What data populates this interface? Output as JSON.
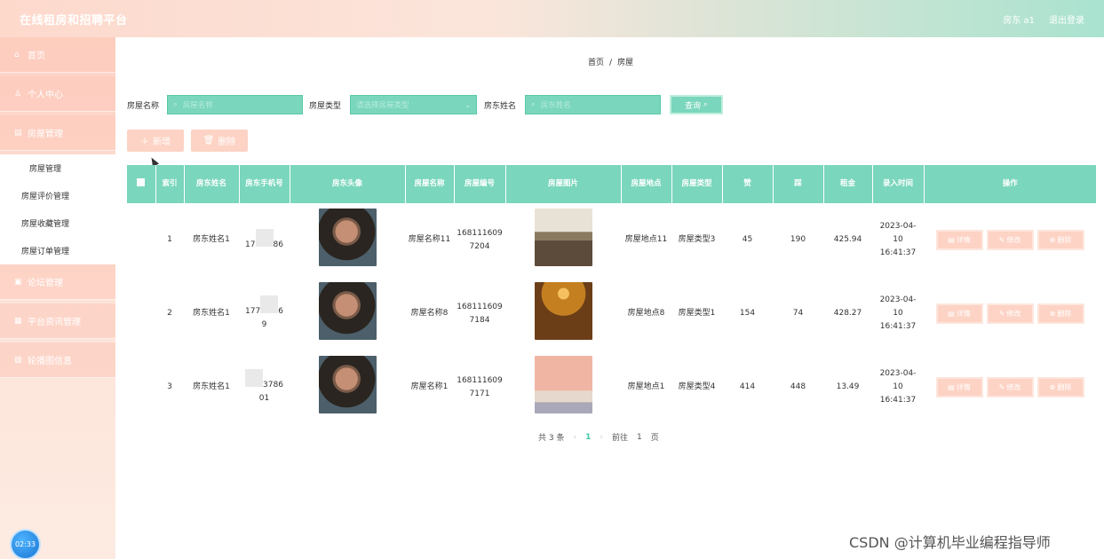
{
  "header": {
    "title": "在线租房和招聘平台",
    "user": "房东 a1",
    "logout": "退出登录"
  },
  "sidebar": {
    "items": [
      {
        "label": "首页",
        "icon": "home-icon"
      },
      {
        "label": "个人中心",
        "icon": "user-icon"
      },
      {
        "label": "房屋管理",
        "icon": "house-icon"
      }
    ],
    "submenu": [
      "房屋管理",
      "房屋评价管理",
      "房屋收藏管理",
      "房屋订单管理"
    ],
    "items2": [
      {
        "label": "论坛管理",
        "icon": "forum-icon"
      },
      {
        "label": "平台资讯管理",
        "icon": "news-icon"
      },
      {
        "label": "轮播图信息",
        "icon": "image-icon"
      }
    ]
  },
  "clock": "02:33",
  "breadcrumb": {
    "home": "首页",
    "sep": "/",
    "current": "房屋"
  },
  "search": {
    "name_label": "房屋名称",
    "name_placeholder": "房屋名称",
    "type_label": "房屋类型",
    "type_placeholder": "请选择房屋类型",
    "owner_label": "房东姓名",
    "owner_placeholder": "房东姓名",
    "query": "查询"
  },
  "actions": {
    "add": "新增",
    "delete": "删除"
  },
  "table": {
    "headers": [
      "",
      "索引",
      "房东姓名",
      "房东手机号",
      "房东头像",
      "房屋名称",
      "房屋编号",
      "房屋图片",
      "房屋地点",
      "房屋类型",
      "赞",
      "踩",
      "租金",
      "录入时间",
      "操作"
    ],
    "rows": [
      {
        "index": "1",
        "owner": "房东姓名1",
        "phone_a": "17",
        "phone_b": "86",
        "phone_c": "",
        "name": "房屋名称11",
        "code": "1681116097204",
        "location": "房屋地点11",
        "type": "房屋类型3",
        "likes": "45",
        "dislikes": "190",
        "rent": "425.94",
        "time": "2023-04-10 16:41:37"
      },
      {
        "index": "2",
        "owner": "房东姓名1",
        "phone_a": "177",
        "phone_b": "6",
        "phone_c": "9",
        "name": "房屋名称8",
        "code": "1681116097184",
        "location": "房屋地点8",
        "type": "房屋类型1",
        "likes": "154",
        "dislikes": "74",
        "rent": "428.27",
        "time": "2023-04-10 16:41:37"
      },
      {
        "index": "3",
        "owner": "房东姓名1",
        "phone_a": "",
        "phone_b": "3786",
        "phone_c": "01",
        "name": "房屋名称1",
        "code": "1681116097171",
        "location": "房屋地点1",
        "type": "房屋类型4",
        "likes": "414",
        "dislikes": "448",
        "rent": "13.49",
        "time": "2023-04-10 16:41:37"
      }
    ],
    "ops": {
      "detail": "详情",
      "edit": "修改",
      "delete": "删除"
    }
  },
  "pager": {
    "total": "共 3 条",
    "page": "1",
    "goto": "前往",
    "goto_page": "1",
    "unit": "页"
  },
  "watermark": "CSDN @计算机毕业编程指导师"
}
